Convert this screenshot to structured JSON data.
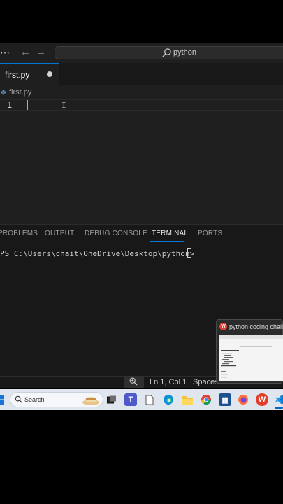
{
  "titlebar": {
    "menu_icon": "menu-dots-icon",
    "back_icon": "arrow-left-icon",
    "forward_icon": "arrow-right-icon",
    "search_icon": "search-icon",
    "command_center_text": "python"
  },
  "tabs": [
    {
      "label": "first.py",
      "modified": true,
      "active": true
    }
  ],
  "breadcrumb": {
    "label": "first.py",
    "icon": "python-file-icon"
  },
  "editor": {
    "line_numbers": [
      "1"
    ],
    "lines": [
      ""
    ]
  },
  "panel": {
    "tabs": [
      "PROBLEMS",
      "OUTPUT",
      "DEBUG CONSOLE",
      "TERMINAL",
      "PORTS"
    ],
    "active_tab": "TERMINAL",
    "terminal_prompt": "PS C:\\Users\\chait\\OneDrive\\Desktop\\python> "
  },
  "statusbar": {
    "zoom_icon": "zoom-in-icon",
    "cursor_position": "Ln 1, Col 1",
    "spaces": "Spaces"
  },
  "thumbnail": {
    "title": "python coding challenge"
  },
  "taskbar": {
    "search_placeholder": "Search",
    "apps": [
      "start-icon",
      "task-view-icon",
      "teams-icon",
      "file-icon",
      "edge-icon",
      "file-explorer-icon",
      "chrome-icon",
      "store-icon",
      "firefox-icon",
      "wps-office-icon",
      "vscode-icon"
    ]
  },
  "colors": {
    "accent": "#0078d4",
    "editor_bg": "#1f1f1f",
    "panel_bg": "#181818",
    "taskbar_bg": "#dfe6ee"
  }
}
